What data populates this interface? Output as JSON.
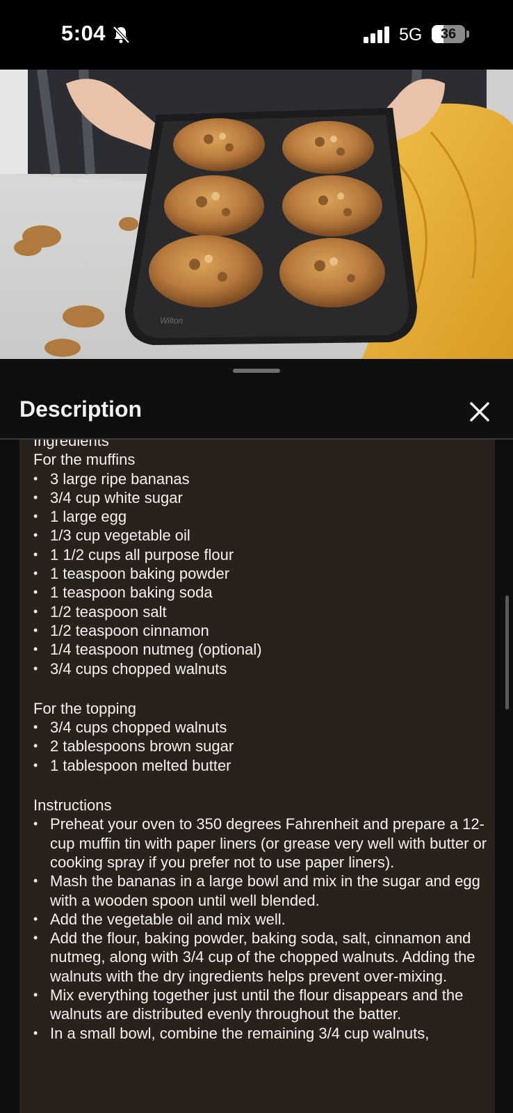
{
  "status_bar": {
    "time": "5:04",
    "network": "5G",
    "battery_percent": "36",
    "battery_level": 0.36
  },
  "sheet": {
    "title": "Description",
    "close_icon": "close-icon"
  },
  "description": {
    "ingredients_heading": "Ingredients",
    "muffins_heading": "For the muffins",
    "muffin_items": [
      "3 large ripe bananas",
      "3/4 cup white sugar",
      "1 large egg",
      "1/3 cup vegetable oil",
      "1 1/2 cups all purpose flour",
      "1 teaspoon baking powder",
      "1 teaspoon baking soda",
      "1/2 teaspoon salt",
      "1/2 teaspoon cinnamon",
      "1/4 teaspoon nutmeg (optional)",
      "3/4 cups chopped walnuts"
    ],
    "topping_heading": "For the topping",
    "topping_items": [
      "3/4 cups chopped walnuts",
      "2 tablespoons brown sugar",
      "1 tablespoon melted butter"
    ],
    "instructions_heading": "Instructions",
    "instruction_items": [
      "Preheat your oven to 350 degrees Fahrenheit and prepare a 12-cup muffin tin with paper liners (or grease very well with butter or cooking spray if you prefer not to use paper liners).",
      "Mash the bananas in a large bowl and mix in the sugar and egg with a wooden spoon until well blended.",
      "Add the vegetable oil and mix well.",
      "Add the flour, baking powder, baking soda, salt, cinnamon and nutmeg, along with 3/4 cup of the chopped walnuts. Adding the walnuts with the dry ingredients helps prevent over-mixing.",
      "Mix everything together just until the flour disappears and the walnuts are distributed evenly throughout the batter.",
      "In a small bowl, combine the remaining 3/4 cup walnuts,"
    ]
  },
  "colors": {
    "background": "#0f0f0f",
    "description_card": "#2b211b",
    "text": "#f1f1f1"
  }
}
